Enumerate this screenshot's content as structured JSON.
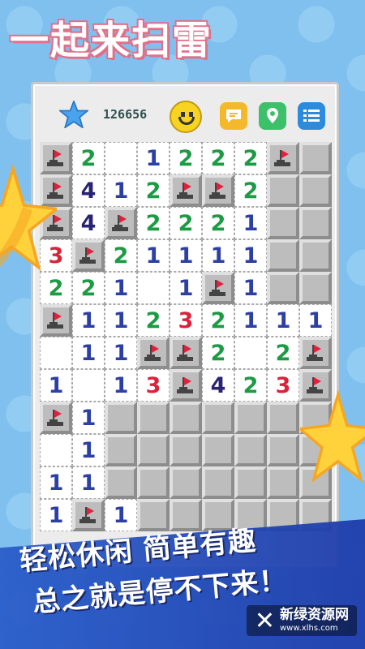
{
  "app_title": "一起来扫雷",
  "score": "126656",
  "slogan": {
    "line1": "轻松休闲  简单有趣",
    "line2": "总之就是停不下来！"
  },
  "watermark": {
    "name": "新绿资源网",
    "domain": "www.xlhs.com"
  },
  "icons": {
    "star": "star-icon",
    "smiley": "smiley-face-icon",
    "chat": "chat-bubble-icon",
    "location": "location-pin-icon",
    "menu": "list-menu-icon",
    "flag": "flag-icon"
  },
  "colors": {
    "background": "#7fc0ef",
    "title_outline": "#e0708a",
    "num1": "#2d3fa3",
    "num2": "#1c9a44",
    "num3": "#d8233a",
    "num4": "#2a2373",
    "flag": "#e1203e"
  },
  "board": {
    "columns": 9,
    "legend": "F = flag, H = hidden, E = empty revealed, digit = revealed number",
    "rows": [
      [
        "F",
        "2",
        "E",
        "1",
        "2",
        "2",
        "2",
        "F",
        "H"
      ],
      [
        "F",
        "4",
        "1",
        "2",
        "F",
        "F",
        "2",
        "H",
        "H"
      ],
      [
        "F",
        "4",
        "F",
        "2",
        "2",
        "2",
        "1",
        "H",
        "H"
      ],
      [
        "3",
        "F",
        "2",
        "1",
        "1",
        "1",
        "1",
        "H",
        "H"
      ],
      [
        "2",
        "2",
        "1",
        "E",
        "1",
        "F",
        "1",
        "H",
        "H"
      ],
      [
        "F",
        "1",
        "1",
        "2",
        "3",
        "2",
        "1",
        "1",
        "1"
      ],
      [
        "E",
        "1",
        "1",
        "F",
        "F",
        "2",
        "E",
        "2",
        "F"
      ],
      [
        "1",
        "E",
        "1",
        "3",
        "F",
        "4",
        "2",
        "3",
        "F"
      ],
      [
        "F",
        "1",
        "H",
        "H",
        "H",
        "H",
        "H",
        "H",
        "H"
      ],
      [
        "E",
        "1",
        "H",
        "H",
        "H",
        "H",
        "H",
        "H",
        "H"
      ],
      [
        "1",
        "1",
        "H",
        "H",
        "H",
        "H",
        "H",
        "H",
        "H"
      ],
      [
        "1",
        "F",
        "1",
        "H",
        "H",
        "H",
        "H",
        "H",
        "H"
      ]
    ]
  }
}
